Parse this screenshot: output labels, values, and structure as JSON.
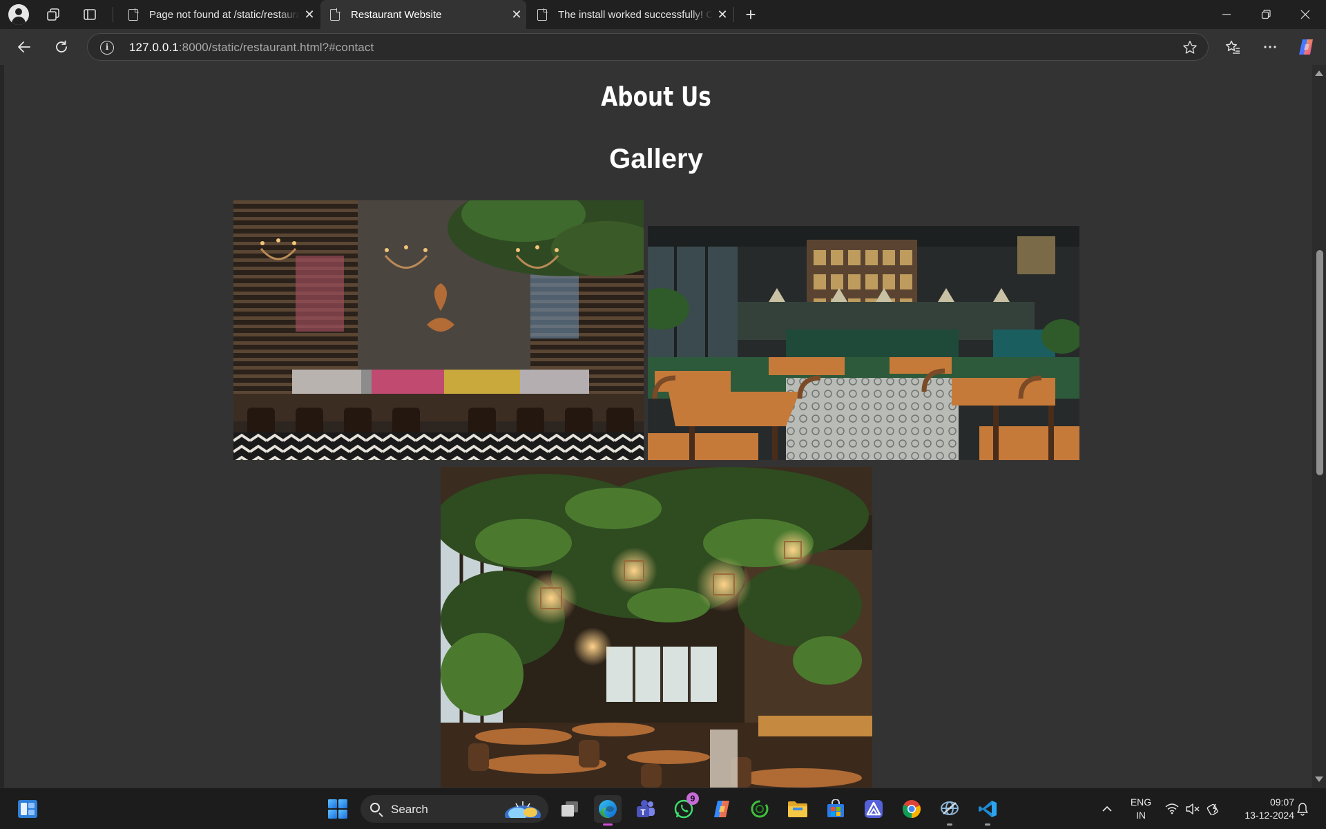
{
  "browser": {
    "tabs": [
      {
        "title": "Page not found at /static/restaurant.html",
        "active": false
      },
      {
        "title": "Restaurant Website",
        "active": true
      },
      {
        "title": "The install worked successfully! Congratulations!",
        "active": false
      }
    ],
    "address": {
      "host": "127.0.0.1",
      "rest": ":8000/static/restaurant.html?#contact"
    }
  },
  "page": {
    "about_heading": "About Us",
    "gallery_heading": "Gallery",
    "gallery_images": [
      {
        "name": "dark wood dining room with chandeliers and patterned banquette"
      },
      {
        "name": "restaurant bar with pendant lights and wooden tables"
      },
      {
        "name": "plant-filled restaurant with hanging lanterns"
      }
    ]
  },
  "taskbar": {
    "search_label": "Search",
    "whatsapp_badge": "9",
    "language": [
      "ENG",
      "IN"
    ],
    "time": "09:07",
    "date": "13-12-2024"
  },
  "colors": {
    "page_bg": "#333333",
    "chrome_bg": "#202020",
    "edge_accent": "#d14fd8"
  }
}
